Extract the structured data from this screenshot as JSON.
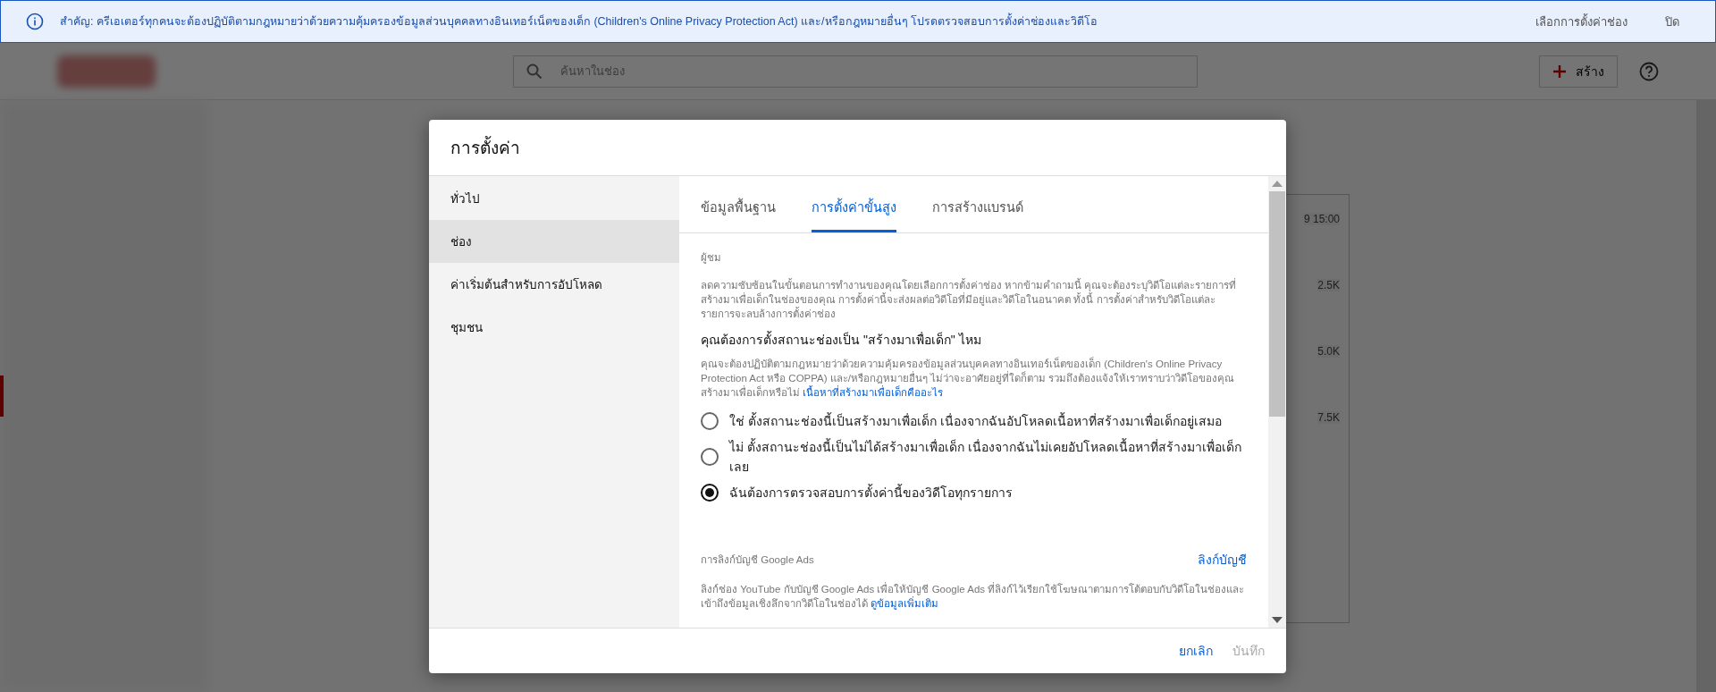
{
  "banner": {
    "text": "สำคัญ: ครีเอเตอร์ทุกคนจะต้องปฏิบัติตามกฎหมายว่าด้วยความคุ้มครองข้อมูลส่วนบุคคลทางอินเทอร์เน็ตของเด็ก (Children's Online Privacy Protection Act) และ/หรือกฎหมายอื่นๆ โปรดตรวจสอบการตั้งค่าช่องและวิดีโอ",
    "actions": [
      "เลือกการตั้งค่าช่อง",
      "ปิด"
    ]
  },
  "header": {
    "search_placeholder": "ค้นหาในช่อง",
    "create_label": "สร้าง"
  },
  "background_chart": {
    "labels": [
      "9 15:00",
      "2.5K",
      "5.0K",
      "7.5K"
    ]
  },
  "dialog": {
    "title": "การตั้งค่า",
    "nav": [
      {
        "label": "ทั่วไป",
        "selected": false
      },
      {
        "label": "ช่อง",
        "selected": true
      },
      {
        "label": "ค่าเริ่มต้นสำหรับการอัปโหลด",
        "selected": false
      },
      {
        "label": "ชุมชน",
        "selected": false
      }
    ],
    "tabs": [
      {
        "label": "ข้อมูลพื้นฐาน",
        "selected": false
      },
      {
        "label": "การตั้งค่าขั้นสูง",
        "selected": true
      },
      {
        "label": "การสร้างแบรนด์",
        "selected": false
      }
    ],
    "audience": {
      "section_label": "ผู้ชม",
      "description": "ลดความซับซ้อนในขั้นตอนการทำงานของคุณโดยเลือกการตั้งค่าช่อง หากข้ามคำถามนี้ คุณจะต้องระบุวิดีโอแต่ละรายการที่สร้างมาเพื่อเด็กในช่องของคุณ การตั้งค่านี้จะส่งผลต่อวิดีโอที่มีอยู่และวิดีโอในอนาคต ทั้งนี้ การตั้งค่าสำหรับวิดีโอแต่ละรายการจะลบล้างการตั้งค่าช่อง",
      "question": "คุณต้องการตั้งสถานะช่องเป็น \"สร้างมาเพื่อเด็ก\" ไหม",
      "legal_text": "คุณจะต้องปฏิบัติตามกฎหมายว่าด้วยความคุ้มครองข้อมูลส่วนบุคคลทางอินเทอร์เน็ตของเด็ก (Children's Online Privacy Protection Act หรือ COPPA) และ/หรือกฎหมายอื่นๆ ไม่ว่าจะอาศัยอยู่ที่ใดก็ตาม รวมถึงต้องแจ้งให้เราทราบว่าวิดีโอของคุณสร้างมาเพื่อเด็กหรือไม่",
      "legal_link": "เนื้อหาที่สร้างมาเพื่อเด็กคืออะไร",
      "options": [
        {
          "label": "ใช่ ตั้งสถานะช่องนี้เป็นสร้างมาเพื่อเด็ก เนื่องจากฉันอัปโหลดเนื้อหาที่สร้างมาเพื่อเด็กอยู่เสมอ",
          "selected": false
        },
        {
          "label": "ไม่ ตั้งสถานะช่องนี้เป็นไม่ได้สร้างมาเพื่อเด็ก เนื่องจากฉันไม่เคยอัปโหลดเนื้อหาที่สร้างมาเพื่อเด็กเลย",
          "selected": false
        },
        {
          "label": "ฉันต้องการตรวจสอบการตั้งค่านี้ของวิดีโอทุกรายการ",
          "selected": true
        }
      ]
    },
    "ads": {
      "section_label": "การลิงก์บัญชี Google Ads",
      "action": "ลิงก์บัญชี",
      "description": "ลิงก์ช่อง YouTube กับบัญชี Google Ads เพื่อให้บัญชี Google Ads ที่ลิงก์ไว้เรียกใช้โฆษณาตามการโต้ตอบกับวิดีโอในช่องและเข้าถึงข้อมูลเชิงลึกจากวิดีโอในช่องได้",
      "link": "ดูข้อมูลเพิ่มเติม"
    },
    "footer": {
      "cancel": "ยกเลิก",
      "save": {
        "label": "บันทึก",
        "disabled": true
      }
    }
  }
}
